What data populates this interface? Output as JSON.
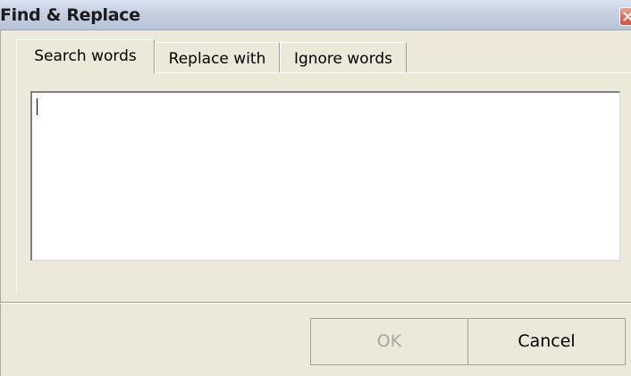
{
  "window": {
    "title": "Find & Replace",
    "close_icon": "close-x-icon"
  },
  "tabs": [
    {
      "label": "Search words",
      "active": true
    },
    {
      "label": "Replace with",
      "active": false
    },
    {
      "label": "Ignore words",
      "active": false
    }
  ],
  "search_words": {
    "value": ""
  },
  "buttons": {
    "ok_label": "OK",
    "ok_enabled": false,
    "cancel_label": "Cancel"
  },
  "colors": {
    "close_button": "#e66b54",
    "titlebar": "#c6d0e0",
    "disabled_text": "#a7a6a0"
  }
}
